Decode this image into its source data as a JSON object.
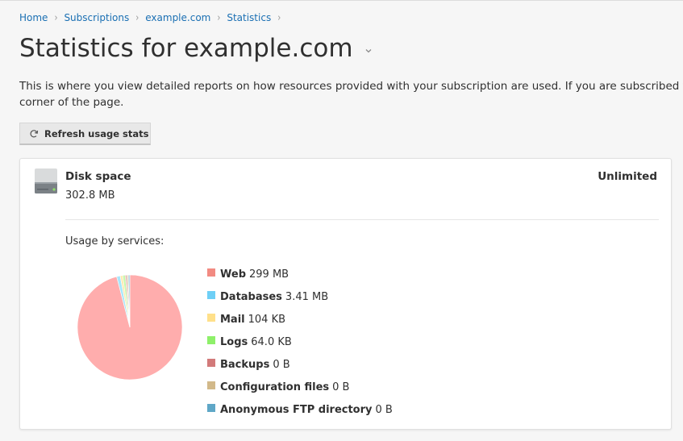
{
  "breadcrumb": {
    "items": [
      "Home",
      "Subscriptions",
      "example.com",
      "Statistics"
    ]
  },
  "page": {
    "title": "Statistics for example.com",
    "description": "This is where you view detailed reports on how resources provided with your subscription are used. If you are subscribed to se corner of the page."
  },
  "toolbar": {
    "refresh_label": "Refresh usage stats"
  },
  "disk": {
    "title": "Disk space",
    "value": "302.8 MB",
    "limit": "Unlimited",
    "usage_label": "Usage by services:"
  },
  "legend": [
    {
      "name": "Web",
      "value": "299 MB",
      "color": "#f28b82"
    },
    {
      "name": "Databases",
      "value": "3.41 MB",
      "color": "#6ecff6"
    },
    {
      "name": "Mail",
      "value": "104 KB",
      "color": "#ffe08a"
    },
    {
      "name": "Logs",
      "value": "64.0 KB",
      "color": "#8ef06a"
    },
    {
      "name": "Backups",
      "value": "0 B",
      "color": "#d27a7a"
    },
    {
      "name": "Configuration files",
      "value": "0 B",
      "color": "#d2b98a"
    },
    {
      "name": "Anonymous FTP directory",
      "value": "0 B",
      "color": "#5fa7c7"
    }
  ],
  "chart_data": {
    "type": "pie",
    "categories": [
      "Web",
      "Databases",
      "Mail",
      "Logs",
      "Backups",
      "Configuration files",
      "Anonymous FTP directory"
    ],
    "values": [
      299,
      3.41,
      0.104,
      0.064,
      0,
      0,
      0
    ],
    "unit": "MB",
    "colors": [
      "#ffadad",
      "#a8e6fb",
      "#ffeab0",
      "#c6f7ad",
      "#e2a5a5",
      "#e3d2b0",
      "#9ccae0"
    ]
  }
}
